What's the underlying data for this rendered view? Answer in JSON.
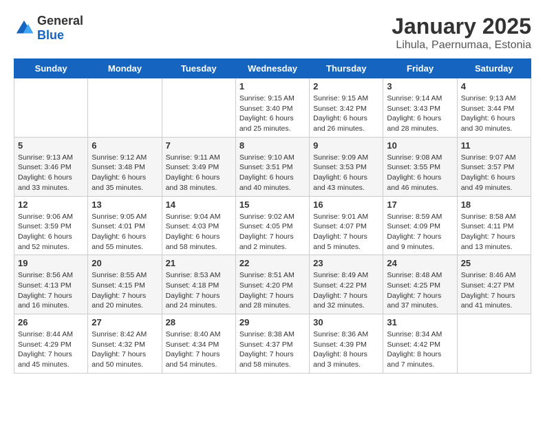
{
  "header": {
    "logo_general": "General",
    "logo_blue": "Blue",
    "title": "January 2025",
    "subtitle": "Lihula, Paernumaa, Estonia"
  },
  "weekdays": [
    "Sunday",
    "Monday",
    "Tuesday",
    "Wednesday",
    "Thursday",
    "Friday",
    "Saturday"
  ],
  "weeks": [
    [
      {
        "day": "",
        "info": ""
      },
      {
        "day": "",
        "info": ""
      },
      {
        "day": "",
        "info": ""
      },
      {
        "day": "1",
        "info": "Sunrise: 9:15 AM\nSunset: 3:40 PM\nDaylight: 6 hours and 25 minutes."
      },
      {
        "day": "2",
        "info": "Sunrise: 9:15 AM\nSunset: 3:42 PM\nDaylight: 6 hours and 26 minutes."
      },
      {
        "day": "3",
        "info": "Sunrise: 9:14 AM\nSunset: 3:43 PM\nDaylight: 6 hours and 28 minutes."
      },
      {
        "day": "4",
        "info": "Sunrise: 9:13 AM\nSunset: 3:44 PM\nDaylight: 6 hours and 30 minutes."
      }
    ],
    [
      {
        "day": "5",
        "info": "Sunrise: 9:13 AM\nSunset: 3:46 PM\nDaylight: 6 hours and 33 minutes."
      },
      {
        "day": "6",
        "info": "Sunrise: 9:12 AM\nSunset: 3:48 PM\nDaylight: 6 hours and 35 minutes."
      },
      {
        "day": "7",
        "info": "Sunrise: 9:11 AM\nSunset: 3:49 PM\nDaylight: 6 hours and 38 minutes."
      },
      {
        "day": "8",
        "info": "Sunrise: 9:10 AM\nSunset: 3:51 PM\nDaylight: 6 hours and 40 minutes."
      },
      {
        "day": "9",
        "info": "Sunrise: 9:09 AM\nSunset: 3:53 PM\nDaylight: 6 hours and 43 minutes."
      },
      {
        "day": "10",
        "info": "Sunrise: 9:08 AM\nSunset: 3:55 PM\nDaylight: 6 hours and 46 minutes."
      },
      {
        "day": "11",
        "info": "Sunrise: 9:07 AM\nSunset: 3:57 PM\nDaylight: 6 hours and 49 minutes."
      }
    ],
    [
      {
        "day": "12",
        "info": "Sunrise: 9:06 AM\nSunset: 3:59 PM\nDaylight: 6 hours and 52 minutes."
      },
      {
        "day": "13",
        "info": "Sunrise: 9:05 AM\nSunset: 4:01 PM\nDaylight: 6 hours and 55 minutes."
      },
      {
        "day": "14",
        "info": "Sunrise: 9:04 AM\nSunset: 4:03 PM\nDaylight: 6 hours and 58 minutes."
      },
      {
        "day": "15",
        "info": "Sunrise: 9:02 AM\nSunset: 4:05 PM\nDaylight: 7 hours and 2 minutes."
      },
      {
        "day": "16",
        "info": "Sunrise: 9:01 AM\nSunset: 4:07 PM\nDaylight: 7 hours and 5 minutes."
      },
      {
        "day": "17",
        "info": "Sunrise: 8:59 AM\nSunset: 4:09 PM\nDaylight: 7 hours and 9 minutes."
      },
      {
        "day": "18",
        "info": "Sunrise: 8:58 AM\nSunset: 4:11 PM\nDaylight: 7 hours and 13 minutes."
      }
    ],
    [
      {
        "day": "19",
        "info": "Sunrise: 8:56 AM\nSunset: 4:13 PM\nDaylight: 7 hours and 16 minutes."
      },
      {
        "day": "20",
        "info": "Sunrise: 8:55 AM\nSunset: 4:15 PM\nDaylight: 7 hours and 20 minutes."
      },
      {
        "day": "21",
        "info": "Sunrise: 8:53 AM\nSunset: 4:18 PM\nDaylight: 7 hours and 24 minutes."
      },
      {
        "day": "22",
        "info": "Sunrise: 8:51 AM\nSunset: 4:20 PM\nDaylight: 7 hours and 28 minutes."
      },
      {
        "day": "23",
        "info": "Sunrise: 8:49 AM\nSunset: 4:22 PM\nDaylight: 7 hours and 32 minutes."
      },
      {
        "day": "24",
        "info": "Sunrise: 8:48 AM\nSunset: 4:25 PM\nDaylight: 7 hours and 37 minutes."
      },
      {
        "day": "25",
        "info": "Sunrise: 8:46 AM\nSunset: 4:27 PM\nDaylight: 7 hours and 41 minutes."
      }
    ],
    [
      {
        "day": "26",
        "info": "Sunrise: 8:44 AM\nSunset: 4:29 PM\nDaylight: 7 hours and 45 minutes."
      },
      {
        "day": "27",
        "info": "Sunrise: 8:42 AM\nSunset: 4:32 PM\nDaylight: 7 hours and 50 minutes."
      },
      {
        "day": "28",
        "info": "Sunrise: 8:40 AM\nSunset: 4:34 PM\nDaylight: 7 hours and 54 minutes."
      },
      {
        "day": "29",
        "info": "Sunrise: 8:38 AM\nSunset: 4:37 PM\nDaylight: 7 hours and 58 minutes."
      },
      {
        "day": "30",
        "info": "Sunrise: 8:36 AM\nSunset: 4:39 PM\nDaylight: 8 hours and 3 minutes."
      },
      {
        "day": "31",
        "info": "Sunrise: 8:34 AM\nSunset: 4:42 PM\nDaylight: 8 hours and 7 minutes."
      },
      {
        "day": "",
        "info": ""
      }
    ]
  ]
}
